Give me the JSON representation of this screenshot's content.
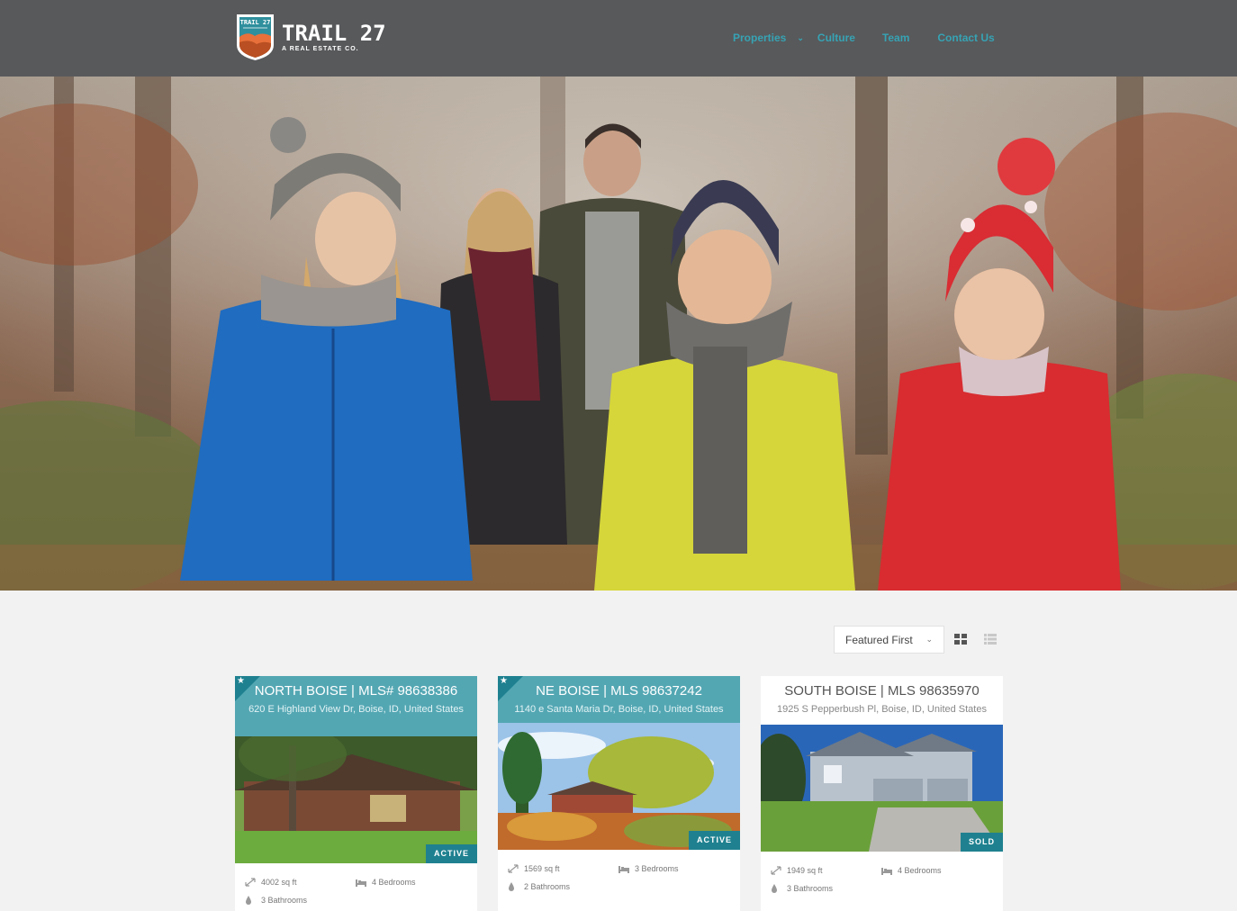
{
  "brand": {
    "badge_text": "TRAIL 27",
    "name": "TRAIL 27",
    "tagline": "A REAL ESTATE CO."
  },
  "nav": {
    "items": [
      {
        "label": "Properties",
        "has_dropdown": true
      },
      {
        "label": "Culture"
      },
      {
        "label": "Team"
      },
      {
        "label": "Contact Us"
      }
    ]
  },
  "toolbar": {
    "sort_selected": "Featured First",
    "views": [
      "grid-view-icon",
      "list-view-icon"
    ],
    "active_view": "grid"
  },
  "colors": {
    "header": "#58595b",
    "accent": "#36a3b4",
    "featured_header": "#53a7b3",
    "badge": "#1f8190"
  },
  "listings": [
    {
      "title": "NORTH BOISE | MLS# 98638386",
      "address": "620 E Highland View Dr, Boise, ID, United States",
      "featured": true,
      "status": "ACTIVE",
      "sqft": "4002 sq ft",
      "bedrooms": "4 Bedrooms",
      "bathrooms": "3 Bathrooms"
    },
    {
      "title": "NE BOISE | MLS 98637242",
      "address": "1140 e Santa Maria Dr, Boise, ID, United States",
      "featured": true,
      "status": "ACTIVE",
      "sqft": "1569 sq ft",
      "bedrooms": "3 Bedrooms",
      "bathrooms": "2 Bathrooms"
    },
    {
      "title": "SOUTH BOISE | MLS 98635970",
      "address": "1925 S Pepperbush Pl, Boise, ID, United States",
      "featured": false,
      "status": "SOLD",
      "sqft": "1949 sq ft",
      "bedrooms": "4 Bedrooms",
      "bathrooms": "3 Bathrooms"
    }
  ]
}
